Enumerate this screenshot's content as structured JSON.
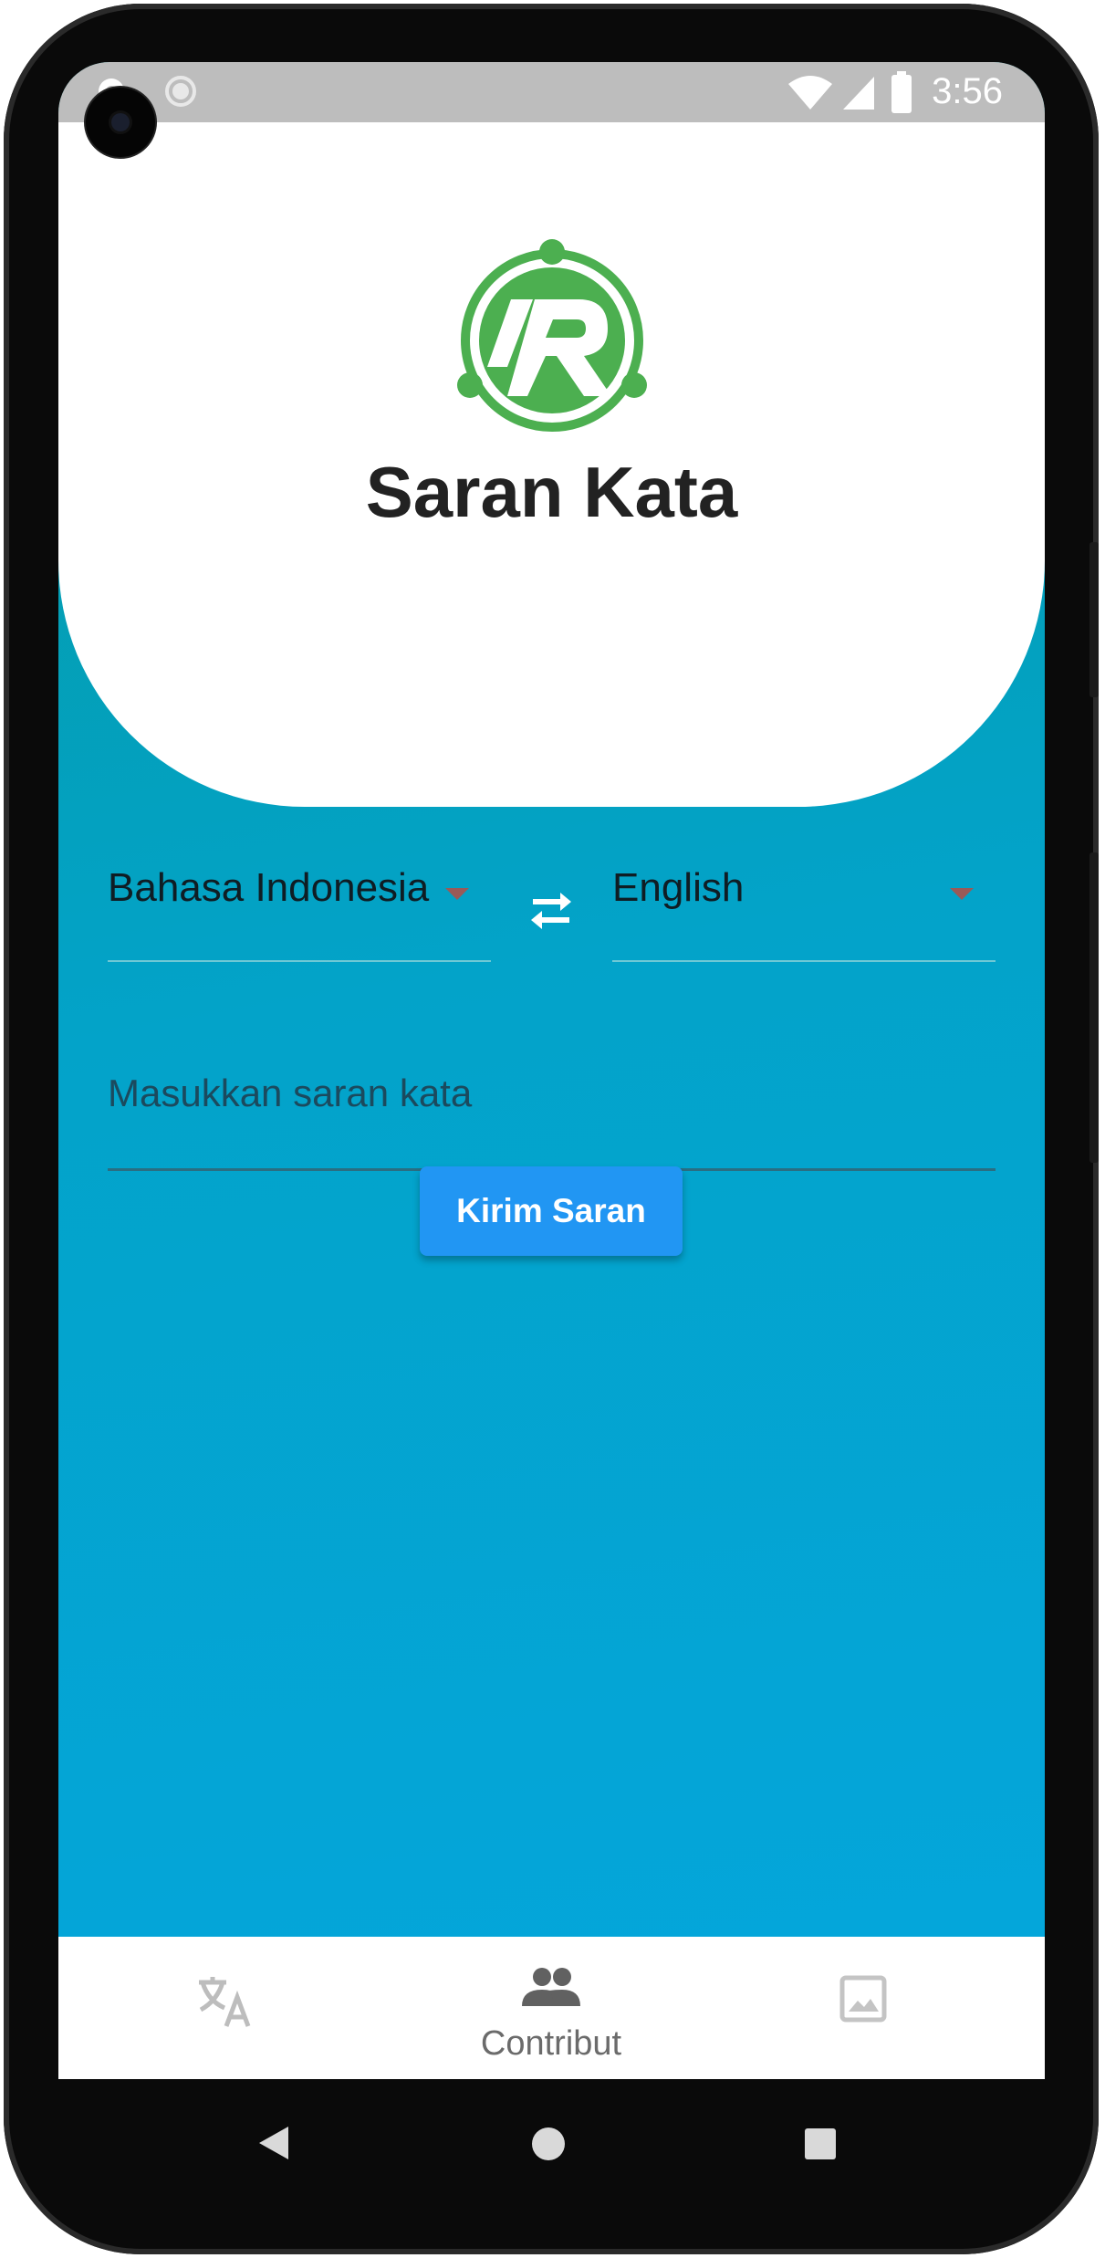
{
  "status_bar": {
    "time": "3:56"
  },
  "app": {
    "title": "Saran Kata"
  },
  "language_selector": {
    "source_language": "Bahasa Indonesia",
    "target_language": "English"
  },
  "suggestion_input": {
    "placeholder": "Masukkan saran kata",
    "value": ""
  },
  "submit_button": {
    "label": "Kirim Saran"
  },
  "bottom_nav": {
    "items": [
      {
        "icon": "translate-icon",
        "label": "",
        "active": false
      },
      {
        "icon": "people-icon",
        "label": "Contribut",
        "active": true
      },
      {
        "icon": "image-icon",
        "label": "",
        "active": false
      }
    ]
  },
  "colors": {
    "accent_green": "#4caf50",
    "button_blue": "#2196f3",
    "background_gradient_start": "#049a9f",
    "background_gradient_end": "#04a6dd"
  }
}
